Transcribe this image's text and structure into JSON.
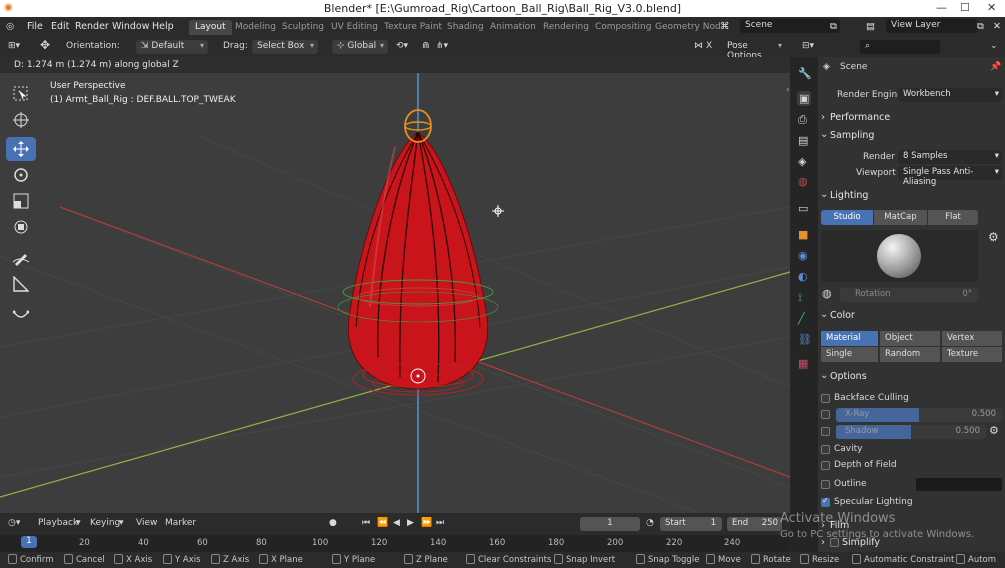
{
  "window": {
    "title": "Blender* [E:\\Gumroad_Rig\\Cartoon_Ball_Rig\\Ball_Rig_V3.0.blend]",
    "controls": [
      "—",
      "☐",
      "✕"
    ]
  },
  "menu": [
    "File",
    "Edit",
    "Render",
    "Window",
    "Help"
  ],
  "workspaces": [
    "Layout",
    "Modeling",
    "Sculpting",
    "UV Editing",
    "Texture Paint",
    "Shading",
    "Animation",
    "Rendering",
    "Compositing",
    "Geometry Nod"
  ],
  "workspace_active": "Layout",
  "scene_field": "Scene",
  "view_layer_field": "View Layer",
  "viewport_header": {
    "orientation_label": "Orientation:",
    "orientation_value": "Default",
    "drag_label": "Drag:",
    "drag_value": "Select Box",
    "transform_value": "Global",
    "pose_options": "Pose Options"
  },
  "viewport": {
    "status_line": "D: 1.274 m (1.274 m) along global Z",
    "perspective": "User Perspective",
    "active_bone": "(1) Armt_Ball_Rig : DEF.BALL.TOP_TWEAK"
  },
  "timeline": {
    "playback": "Playback",
    "keying": "Keying",
    "view": "View",
    "marker": "Marker",
    "current_frame": "1",
    "start_label": "Start",
    "start_value": "1",
    "end_label": "End",
    "end_value": "250",
    "ticks": [
      "1",
      "20",
      "40",
      "60",
      "80",
      "100",
      "120",
      "140",
      "160",
      "180",
      "200",
      "220",
      "240"
    ]
  },
  "status_bar": [
    "Confirm",
    "Cancel",
    "X Axis",
    "Y Axis",
    "Z Axis",
    "X Plane",
    "Y Plane",
    "Z Plane",
    "Clear Constraints",
    "Snap Invert",
    "Snap Toggle",
    "Move",
    "Rotate",
    "Resize",
    "Automatic Constraint",
    "Autom"
  ],
  "properties": {
    "context": "Scene",
    "render_engine_label": "Render Engine",
    "render_engine_value": "Workbench",
    "performance": "Performance",
    "sampling": "Sampling",
    "render_label": "Render",
    "render_value": "8 Samples",
    "viewport_label": "Viewport",
    "viewport_value": "Single Pass Anti-Aliasing",
    "lighting": "Lighting",
    "lighting_modes": [
      "Studio",
      "MatCap",
      "Flat"
    ],
    "rotation_label": "Rotation",
    "rotation_value": "0°",
    "color": "Color",
    "color_modes_row1": [
      "Material",
      "Object",
      "Vertex"
    ],
    "color_modes_row2": [
      "Single",
      "Random",
      "Texture"
    ],
    "options": "Options",
    "backface_culling": "Backface Culling",
    "xray_label": "X-Ray",
    "xray_value": "0.500",
    "shadow_label": "Shadow",
    "shadow_value": "0.500",
    "cavity": "Cavity",
    "depth_of_field": "Depth of Field",
    "outline": "Outline",
    "specular_lighting": "Specular Lighting",
    "film": "Film",
    "simplify": "Simplify"
  },
  "watermark": {
    "line1": "Activate Windows",
    "line2": "Go to PC settings to activate Windows."
  },
  "colors": {
    "accent": "#4772b3",
    "ball": "#c8141a",
    "x_axis": "#c83c3c",
    "y_axis": "#8fb44a",
    "z_axis": "#5a8fd8"
  }
}
